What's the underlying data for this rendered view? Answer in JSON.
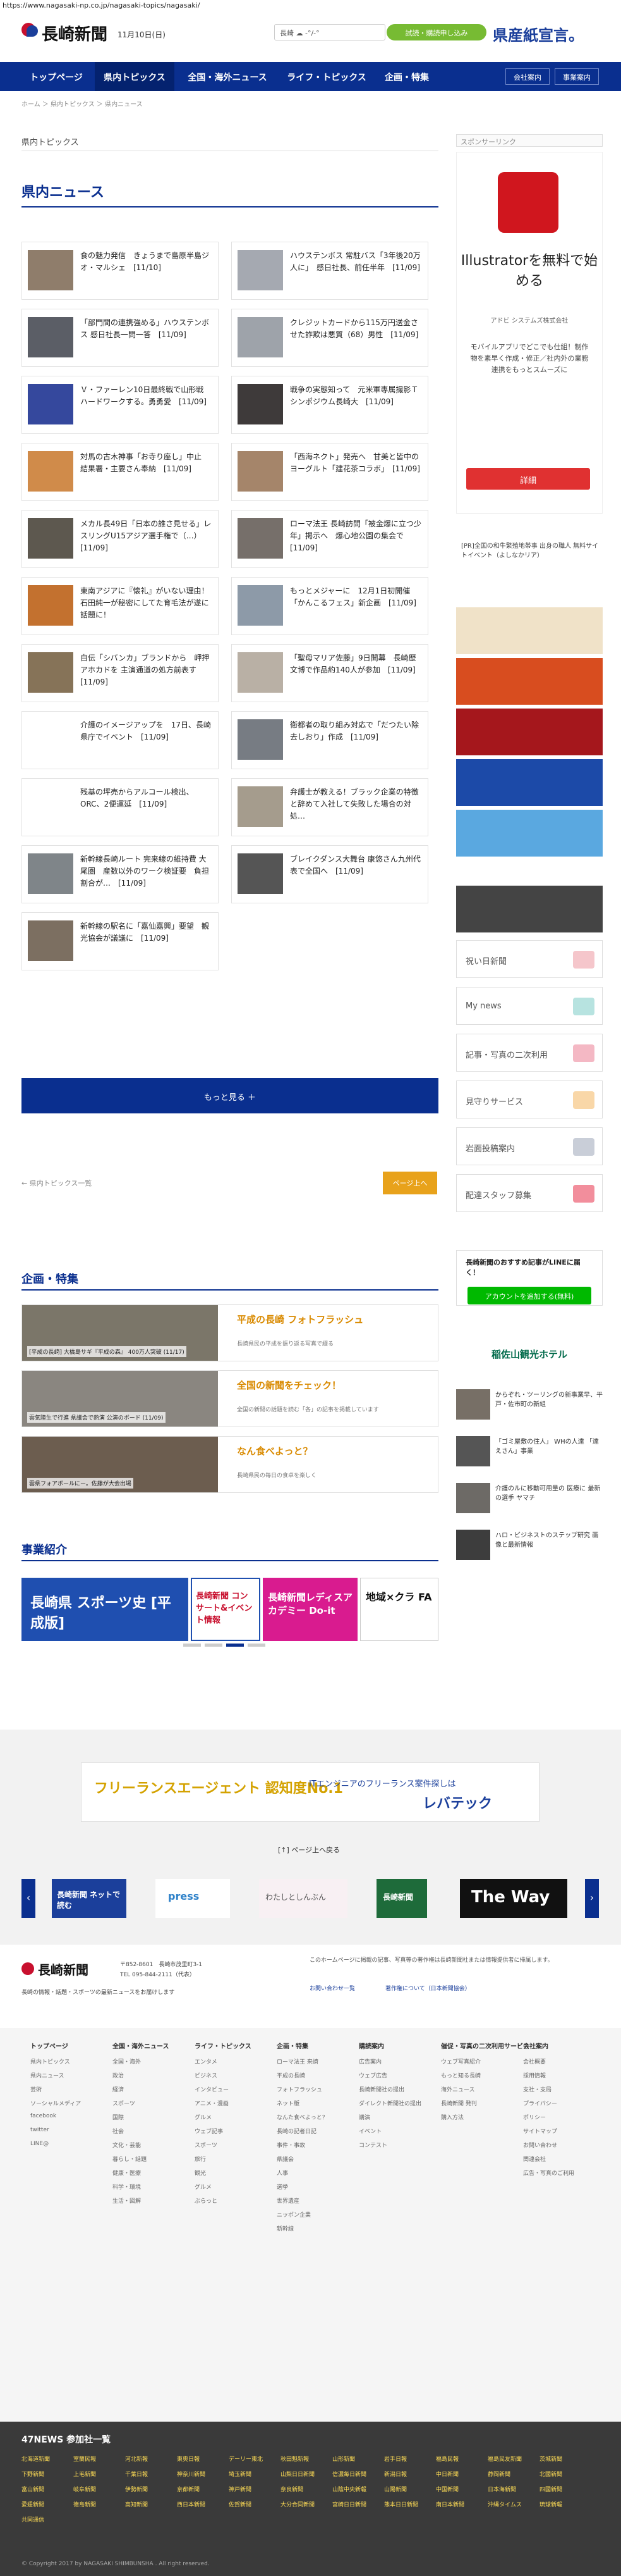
{
  "url": "https://www.nagasaki-np.co.jp/nagasaki-topics/nagasaki/",
  "header": {
    "logo": "長崎新聞",
    "date": "11月10日(日)",
    "weather": "長崎 ☁ -°/-°",
    "trial_button": "試読・購読申し込み",
    "ad_right": "県産紙宣言。"
  },
  "nav": {
    "items": [
      "トップページ",
      "県内トピックス",
      "全国・海外ニュース",
      "ライフ・トピックス",
      "企画・特集"
    ],
    "sub_items": [
      "会社案内",
      "事業案内"
    ]
  },
  "breadcrumb": "ホーム ＞ 県内トピックス ＞ 県内ニュース",
  "page_head": "県内トピックス",
  "section_title": "県内ニュース",
  "news": [
    {
      "title": "食の魅力発信　きょうまで島原半島ジオ・マルシェ　[11/10]"
    },
    {
      "title": "ハウステンボス 常駐バス「3年後20万人に」　感日社長、前任半年　[11/09]"
    },
    {
      "title": "「部門間の連携強める」ハウステンボス 感日社長一問一答　[11/09]"
    },
    {
      "title": "クレジットカードから115万円送金させた詐欺は悪質（68）男性　[11/09]"
    },
    {
      "title": "Ｖ・ファーレン10日最終戦で山形戦　ハードワークする。勇勇愛　[11/09]"
    },
    {
      "title": "戦争の実態知って　元米軍専属撮影Ｔシンポジウム長崎大　[11/09]"
    },
    {
      "title": "対馬の古木神事「お寺り座し」中止　結果署・主要さん奉納　[11/09]"
    },
    {
      "title": "「西海ネクト」発売へ　甘美と皆中のヨーグルト「建花茶コラボ」　[11/09]"
    },
    {
      "title": "メカル長49日「日本の誰さ見せる」レスリングU15アジア選手権で（…）　[11/09]"
    },
    {
      "title": "ローマ法王 長崎訪問「被金爆に立つ少年」掲示へ　爆心地公園の集会で　[11/09]"
    },
    {
      "title": "東南アジアに『懐礼』がいない理由！石田純一が秘密にしてた育毛法が遂に話題に！"
    },
    {
      "title": "もっとメジャーに　12月1日初開催「かんこるフェス」新企画　[11/09]"
    },
    {
      "title": "自伝「シバンカ」ブランドから　岬押アホカドを 主演通道の処方前表す　[11/09]"
    },
    {
      "title": "「聖母マリア佐藤」9日開幕　長崎歴文博で作品約140人が参加　[11/09]"
    },
    {
      "title": "介護のイメージアップを　17日、長崎県庁でイベント　[11/09]"
    },
    {
      "title": "衛都者の取り組み対応で「だつたい除去しおり」作成　[11/09]"
    },
    {
      "title": "残基の坪売からアルコール検出、ORC、2便運延　[11/09]"
    },
    {
      "title": "弁護士が教える！ブラック企業の特徴と辞めて入社して失敗した場合の対処…"
    },
    {
      "title": "新幹線長崎ルート 完来線の維持費 大尾圏　産数以外のワーク検証要　負担割合が…　[11/09]"
    },
    {
      "title": "ブレイクダンス大舞台 康悠さん九州代表で全国へ　[11/09]"
    },
    {
      "title": "新幹線の駅名に「嘉仙嘉興」要望　観光協会が議議に　[11/09]"
    }
  ],
  "more_button": "もっと見る ＋",
  "pager": {
    "prev": "← 県内トピックス一覧",
    "next": "ページ上へ"
  },
  "kikaku": {
    "title": "企画・特集",
    "items": [
      {
        "caption": "[平成の長崎] 大橋島サギ『平成の森』 400万人突破 (11/17)",
        "title": "平成の長崎 フォトフラッシュ",
        "desc": "長崎県民の平成を振り返る写真で綴る"
      },
      {
        "caption": "雲気陸生で行進 県議会で熱演 公演のボード (11/09)",
        "title": "全国の新聞をチェック！",
        "desc": "全国の新聞の話題を読む「各」の記事を掲載しています"
      },
      {
        "caption": "雲県フォアボールにー。佐藤が大会出場",
        "title": "なん食べよっと？",
        "desc": "長崎県民の毎日の食卓を楽しく"
      }
    ]
  },
  "business": {
    "title": "事業紹介",
    "banners": [
      "長崎県 スポーツ史 [平成版]",
      "長崎新聞 コンサート&イベント情報",
      "長崎新聞レディスアカデミー Do-it",
      "地域×クラ FA"
    ]
  },
  "banner_link": "[↑] ページ上へ戻る",
  "levtech": {
    "label": "フリーランスエージェント 認知度No.1",
    "tag": "ITエンジニアのフリーランス案件探しは",
    "brand": "レバテック"
  },
  "carousel": [
    "長崎新聞 ネットで読む",
    "press",
    "わたしとしんぶん",
    "長崎新聞",
    "The Way"
  ],
  "footer": {
    "address": "〒852-8601　長崎市茂里町3-1",
    "tel": "TEL 095-844-2111（代表）",
    "note": "長崎の情報・話題・スポーツの最新ニュースをお届けします",
    "notice": "このホームページに掲載の記事、写真等の著作権は長崎新聞社または情報提供者に帰属します。",
    "links": [
      "お問い合わせ一覧",
      "著作権について（日本新聞協会）"
    ]
  },
  "footer_cols": [
    {
      "title": "トップページ",
      "items": [
        "県内トピックス",
        "県内ニュース",
        "芸術",
        "ソーシャルメディア",
        "facebook",
        "twitter",
        "LINE@"
      ]
    },
    {
      "title": "全国・海外ニュース",
      "items": [
        "全国・海外",
        "政治",
        "経済",
        "スポーツ",
        "国際",
        "社会",
        "文化・芸能",
        "暮らし・話題",
        "健康・医療",
        "科学・環境",
        "生活・図解"
      ]
    },
    {
      "title": "ライフ・トピックス",
      "items": [
        "エンタメ",
        "ビジネス",
        "インタビュー",
        "アニメ・漫画",
        "グルメ",
        "ウェブ記事",
        "スポーツ",
        "旅行",
        "観光",
        "グルメ",
        "ぶらっと"
      ]
    },
    {
      "title": "企画・特集",
      "items": [
        "ローマ法王 来崎",
        "平成の長崎",
        "フォトフラッシュ",
        "ネット版",
        "なんた食べよっと？",
        "長崎の記者日記",
        "事件・事故",
        "県議会",
        "人事",
        "選挙",
        "世界遺産",
        "ニッポン企業",
        "新幹線"
      ]
    },
    {
      "title": "購読案内",
      "items": [
        "広告案内",
        "ウェブ広告",
        "長崎新聞社の提出",
        "ダイレクト新聞社の提出",
        "講演",
        "イベント",
        "コンテスト"
      ]
    },
    {
      "title": "催促・写真の二次利用サービス",
      "items": [
        "ウェブ写真紹介",
        "もっと知る長崎",
        "海外ニュース",
        "長崎新聞 発刊",
        "購入方法"
      ]
    },
    {
      "title": "会社案内",
      "items": [
        "会社概要",
        "採用情報",
        "支社・支局",
        "プライバシー",
        "ポリシー",
        "サイトマップ",
        "お問い合わせ",
        "関連会社",
        "広告・写真のご利用"
      ]
    }
  ],
  "n47": {
    "title": "47NEWS 参加社一覧",
    "links": [
      "北海道新聞",
      "室蘭民報",
      "河北新報",
      "東奥日報",
      "デーリー東北",
      "秋田魁新報",
      "山形新聞",
      "岩手日報",
      "福島民報",
      "福島民友新聞",
      "茨城新聞",
      "下野新聞",
      "上毛新聞",
      "千葉日報",
      "神奈川新聞",
      "埼玉新聞",
      "山梨日日新聞",
      "信濃毎日新聞",
      "新潟日報",
      "中日新聞",
      "静岡新聞",
      "北國新聞",
      "富山新聞",
      "岐阜新聞",
      "伊勢新聞",
      "京都新聞",
      "神戸新聞",
      "奈良新聞",
      "山陰中央新報",
      "山陽新聞",
      "中国新聞",
      "日本海新聞",
      "四國新聞",
      "愛媛新聞",
      "徳島新聞",
      "高知新聞",
      "西日本新聞",
      "佐賀新聞",
      "大分合同新聞",
      "宮崎日日新聞",
      "熊本日日新聞",
      "南日本新聞",
      "沖縄タイムス",
      "琉球新報",
      "共同通信"
    ]
  },
  "copyright": "© Copyright 2017 by NAGASAKI SHIMBUNSHA . All right reserved.",
  "sidebar": {
    "label": "スポンサーリンク",
    "ad_title": "Illustratorを無料で始める",
    "ad_sub": "アドビ システムズ株式会社",
    "ad_desc": "モバイルアプリでどこでも仕組！制作物を素早く作成・修正／社内外の業務連携をもっとスムーズに",
    "ad_btn": "詳細",
    "text_link": "[PR]全国の和牛繁殖地帯事 出身の職人 無料サイトイベント（よしなかリア）",
    "menu": [
      "祝い日新聞",
      "My news",
      "記事・写真の二次利用",
      "見守りサービス",
      "岩面投稿案内",
      "配達スタッフ募集"
    ],
    "line_title": "長崎新聞のおすすめ記事がLINEに届く！",
    "line_btn": "アカウントを追加する(無料)",
    "hotel": "稲佐山観光ホテル",
    "small": [
      "からぞれ・ツーリングの新事業早、平戸・佐市町の新組",
      "「ゴミ屋敷の住人」 WHの人達 「達えさん」事業",
      "介護のルに移動可用量の 医療に 最新の選手 ヤマチ",
      "ハロ・ビジネストのステップ研究 画像と最新情報"
    ]
  }
}
